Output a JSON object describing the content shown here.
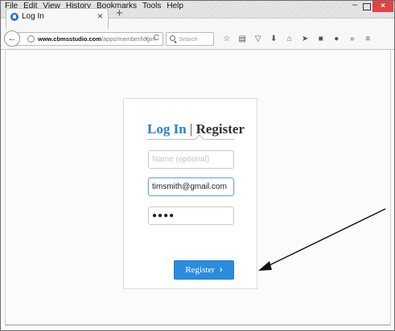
{
  "menu": [
    "File",
    "Edit",
    "View",
    "History",
    "Bookmarks",
    "Tools",
    "Help"
  ],
  "window_controls": {
    "minimize": "–",
    "close": "×"
  },
  "tab": {
    "title": "Log In",
    "close": "×",
    "new_tab": "+"
  },
  "nav": {
    "back": "←",
    "url_domain": "www.cbmsstudio.com",
    "url_path": "/apps/member/login",
    "url_dropdown": "▿",
    "reload": "C",
    "search_placeholder": "Search"
  },
  "toolbar_icons": [
    "star-icon",
    "reading-list-icon",
    "pocket-icon",
    "download-icon",
    "home-icon",
    "send-icon",
    "screenshot-icon",
    "chat-icon",
    "overflow-icon",
    "menu-icon"
  ],
  "toolbar_glyphs": [
    "☆",
    "▤",
    "▽",
    "⬇",
    "⌂",
    "➤",
    "■",
    "●",
    "»",
    "≡"
  ],
  "form": {
    "login_tab": "Log In",
    "separator": "|",
    "register_tab": "Register",
    "name_placeholder": "Name (optional)",
    "email_value": "timsmith@gmail.com",
    "password_masked": "●●●●",
    "submit_label": "Register",
    "submit_chevron": "›"
  },
  "colors": {
    "accent_blue": "#2a7fd4",
    "button_blue": "#2c8ce0",
    "close_red": "#e04343"
  }
}
